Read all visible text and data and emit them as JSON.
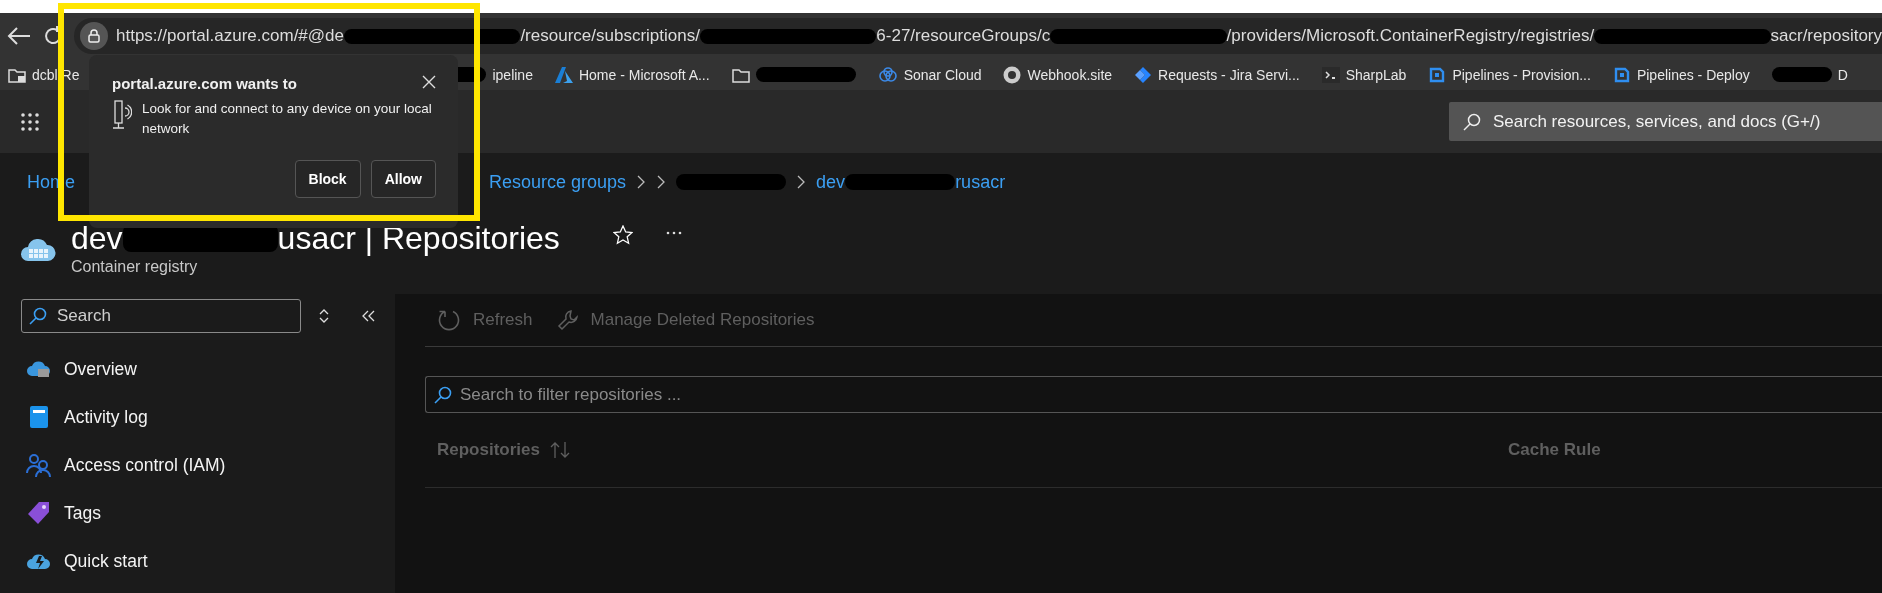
{
  "browser": {
    "address_bar": {
      "segments": [
        {
          "kind": "text",
          "text": "https://portal.azure.com/#@de"
        },
        {
          "kind": "redacted"
        },
        {
          "kind": "text",
          "text": "/resource/subscriptions/"
        },
        {
          "kind": "redacted"
        },
        {
          "kind": "text",
          "text": "6-27/resourceGroups/c"
        },
        {
          "kind": "redacted"
        },
        {
          "kind": "text",
          "text": "/providers/Microsoft.ContainerRegistry/registries/"
        },
        {
          "kind": "redacted"
        },
        {
          "kind": "text",
          "text": "sacr/repository"
        }
      ]
    },
    "bookmarks": [
      {
        "kind": "folder",
        "label": "dcbl Re"
      },
      {
        "kind": "redacted",
        "label": "ipeline"
      },
      {
        "kind": "azure",
        "label": "Home - Microsoft A..."
      },
      {
        "kind": "folder-redacted"
      },
      {
        "kind": "sonar",
        "label": "Sonar Cloud"
      },
      {
        "kind": "webhook",
        "label": "Webhook.site"
      },
      {
        "kind": "jira",
        "label": "Requests - Jira Servi..."
      },
      {
        "kind": "terminal",
        "label": "SharpLab"
      },
      {
        "kind": "pipelines",
        "label": "Pipelines - Provision..."
      },
      {
        "kind": "pipelines",
        "label": "Pipelines - Deploy"
      },
      {
        "kind": "redacted",
        "label": "D"
      }
    ]
  },
  "permission_popup": {
    "title": "portal.azure.com wants to",
    "message": "Look for and connect to any device on your local network",
    "buttons": [
      "Block",
      "Allow"
    ]
  },
  "portal": {
    "search": {
      "placeholder": "Search resources, services, and docs (G+/)"
    },
    "breadcrumb": [
      {
        "segments": [
          {
            "kind": "text",
            "text": "Home"
          }
        ]
      },
      {
        "segments": [
          {
            "kind": "text",
            "text": "Resource groups"
          }
        ]
      },
      {
        "segments": [
          {
            "kind": "redacted"
          }
        ]
      },
      {
        "segments": [
          {
            "kind": "text",
            "text": "dev"
          },
          {
            "kind": "redacted"
          },
          {
            "kind": "text",
            "text": "rusacr"
          }
        ]
      }
    ],
    "title": {
      "segments": [
        {
          "kind": "text",
          "text": "dev"
        },
        {
          "kind": "redacted"
        },
        {
          "kind": "text",
          "text": "usacr | Repositories"
        }
      ],
      "subtitle": "Container registry",
      "favorite": false
    },
    "sidebar": {
      "search": {
        "placeholder": "Search"
      },
      "items": [
        {
          "kind": "overview",
          "label": "Overview"
        },
        {
          "kind": "activity",
          "label": "Activity log"
        },
        {
          "kind": "iam",
          "label": "Access control (IAM)"
        },
        {
          "kind": "tags",
          "label": "Tags"
        },
        {
          "kind": "quickstart",
          "label": "Quick start"
        }
      ]
    },
    "toolbar": [
      {
        "kind": "refresh",
        "label": "Refresh",
        "disabled": true
      },
      {
        "kind": "wrench",
        "label": "Manage Deleted Repositories",
        "disabled": true
      }
    ],
    "filter": {
      "placeholder": "Search to filter repositories ..."
    },
    "table": {
      "columns": [
        {
          "label": "Repositories",
          "sortable": true
        },
        {
          "label": "Cache Rule",
          "sortable": false
        }
      ]
    }
  }
}
